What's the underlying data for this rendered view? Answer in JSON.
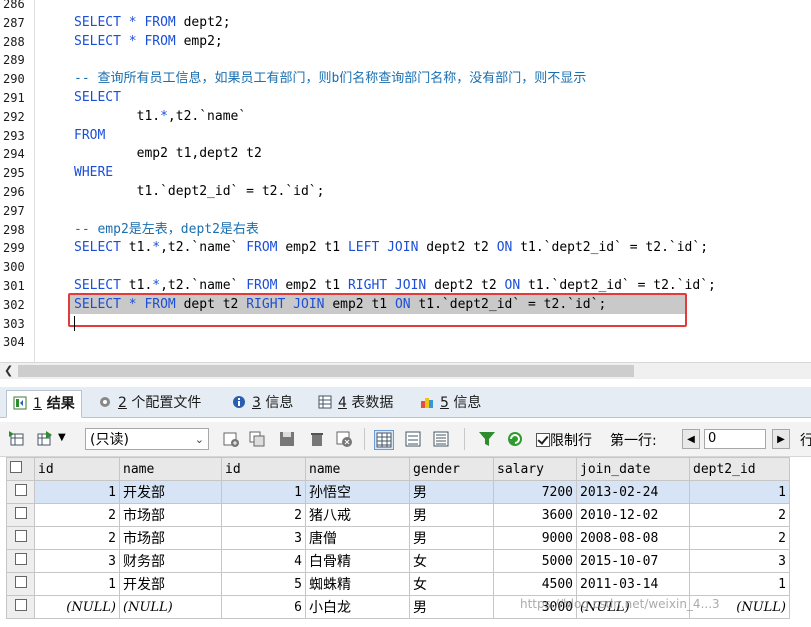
{
  "editor": {
    "lines": [
      {
        "n": "286",
        "parts": []
      },
      {
        "n": "287",
        "parts": [
          [
            "kw",
            "SELECT"
          ],
          [
            "",
            ""
          ],
          [
            "kw",
            " * FROM"
          ],
          [
            "",
            " dept2;"
          ]
        ]
      },
      {
        "n": "288",
        "parts": [
          [
            "kw",
            "SELECT"
          ],
          [
            "kw",
            " * FROM"
          ],
          [
            "",
            " emp2;"
          ]
        ]
      },
      {
        "n": "289",
        "parts": []
      },
      {
        "n": "290",
        "parts": [
          [
            "cm",
            "-- 查询所有员工信息，如果员工有部门，则b们名称查询部门名称，没有部门，则不显示"
          ]
        ]
      },
      {
        "n": "291",
        "parts": [
          [
            "kw",
            "SELECT"
          ]
        ]
      },
      {
        "n": "292",
        "parts": [
          [
            "",
            "        t1."
          ],
          [
            "kw",
            "*"
          ],
          [
            "",
            ",t2.`name`"
          ]
        ]
      },
      {
        "n": "293",
        "parts": [
          [
            "kw",
            "FROM"
          ]
        ]
      },
      {
        "n": "294",
        "parts": [
          [
            "",
            "        emp2 t1,dept2 t2"
          ]
        ]
      },
      {
        "n": "295",
        "parts": [
          [
            "kw",
            "WHERE"
          ]
        ]
      },
      {
        "n": "296",
        "parts": [
          [
            "",
            "        t1.`dept2_id` = t2.`id`;"
          ]
        ]
      },
      {
        "n": "297",
        "parts": []
      },
      {
        "n": "298",
        "parts": [
          [
            "cm",
            "-- emp2是左表，dept2是右表"
          ]
        ]
      },
      {
        "n": "299",
        "parts": [
          [
            "kw",
            "SELECT"
          ],
          [
            "",
            " t1."
          ],
          [
            "kw",
            "*"
          ],
          [
            "",
            ",t2.`name` "
          ],
          [
            "kw",
            "FROM"
          ],
          [
            "",
            " emp2 t1 "
          ],
          [
            "kw",
            "LEFT JOIN"
          ],
          [
            "",
            " dept2 t2 "
          ],
          [
            "kw",
            "ON"
          ],
          [
            "",
            " t1.`dept2_id` = t2.`id`;"
          ]
        ]
      },
      {
        "n": "300",
        "parts": []
      },
      {
        "n": "301",
        "parts": [
          [
            "kw",
            "SELECT"
          ],
          [
            "",
            " t1."
          ],
          [
            "kw",
            "*"
          ],
          [
            "",
            ",t2.`name` "
          ],
          [
            "kw",
            "FROM"
          ],
          [
            "",
            " emp2 t1 "
          ],
          [
            "kw",
            "RIGHT JOIN"
          ],
          [
            "",
            " dept2 t2 "
          ],
          [
            "kw",
            "ON"
          ],
          [
            "",
            " t1.`dept2_id` = t2.`id`;"
          ]
        ]
      },
      {
        "n": "302",
        "parts": [
          [
            "kw",
            "SELECT"
          ],
          [
            "kw",
            " * FROM"
          ],
          [
            "",
            " dept t2 "
          ],
          [
            "kw",
            "RIGHT JOIN"
          ],
          [
            "",
            " emp2 t1 "
          ],
          [
            "kw",
            "ON"
          ],
          [
            "",
            " t1.`dept2_id` = t2.`id`;"
          ]
        ]
      },
      {
        "n": "303",
        "parts": []
      },
      {
        "n": "304",
        "parts": []
      }
    ]
  },
  "tabs": [
    {
      "num": "1",
      "label": " 结果",
      "icon": "result-icon"
    },
    {
      "num": "2",
      "label": " 个配置文件",
      "icon": "profile-icon"
    },
    {
      "num": "3",
      "label": " 信息",
      "icon": "info-icon"
    },
    {
      "num": "4",
      "label": " 表数据",
      "icon": "table-data-icon"
    },
    {
      "num": "5",
      "label": " 信息",
      "icon": "info-icon"
    }
  ],
  "toolbar": {
    "mode": "(只读)",
    "limit_label": "限制行",
    "first_row_label": "第一行:",
    "first_row_value": "0",
    "rows_label": "行"
  },
  "grid": {
    "columns": [
      "id",
      "name",
      "id",
      "name",
      "gender",
      "salary",
      "join_date",
      "dept2_id"
    ],
    "rows": [
      [
        "1",
        "开发部",
        "1",
        "孙悟空",
        "男",
        "7200",
        "2013-02-24",
        "1"
      ],
      [
        "2",
        "市场部",
        "2",
        "猪八戒",
        "男",
        "3600",
        "2010-12-02",
        "2"
      ],
      [
        "2",
        "市场部",
        "3",
        "唐僧",
        "男",
        "9000",
        "2008-08-08",
        "2"
      ],
      [
        "3",
        "财务部",
        "4",
        "白骨精",
        "女",
        "5000",
        "2015-10-07",
        "3"
      ],
      [
        "1",
        "开发部",
        "5",
        "蜘蛛精",
        "女",
        "4500",
        "2011-03-14",
        "1"
      ],
      [
        "(NULL)",
        "(NULL)",
        "6",
        "小白龙",
        "男",
        "3000",
        "(NULL)",
        "(NULL)"
      ]
    ]
  },
  "watermark": "https://blog.csdn.net/weixin_4...3",
  "colors": {
    "keyword": "#1b4fd8",
    "comment": "#1a6fb0",
    "highlight": "#e23b3b"
  }
}
